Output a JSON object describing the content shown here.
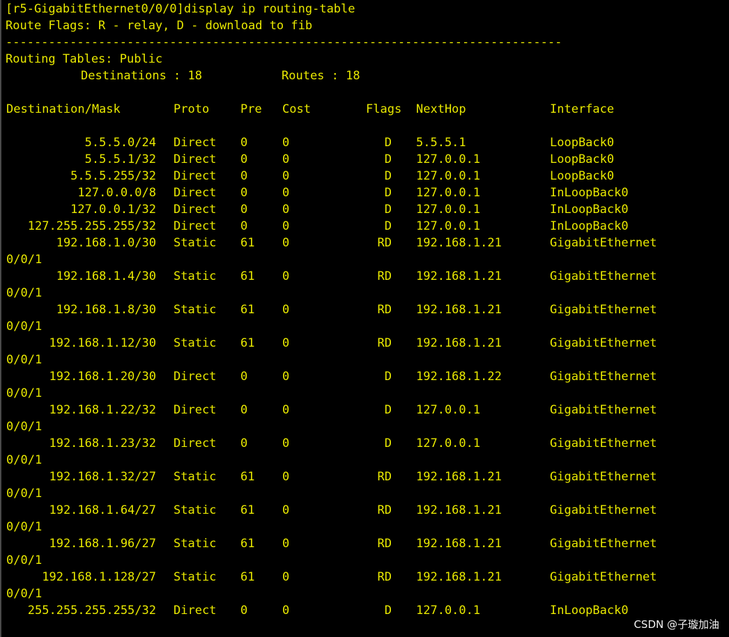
{
  "colors": {
    "background": "#000000",
    "text": "#e8e800",
    "watermark": "#ffffff"
  },
  "command": "[r5-GigabitEthernet0/0/0]display ip routing-table",
  "route_flags": "Route Flags: R - relay, D - download to fib",
  "separator": "------------------------------------------------------------------------------",
  "table_name": "Routing Tables: Public",
  "destinations_label": "Destinations : 18",
  "routes_label": "Routes : 18",
  "headers": {
    "destination": "Destination/Mask",
    "proto": "Proto",
    "pre": "Pre",
    "cost": "Cost",
    "flags": "Flags",
    "nexthop": "NextHop",
    "interface": "Interface"
  },
  "routes": [
    {
      "dest": "5.5.5.0/24",
      "proto": "Direct",
      "pre": "0",
      "cost": "0",
      "flags": "D",
      "nexthop": "5.5.5.1",
      "iface": "LoopBack0",
      "iface2": ""
    },
    {
      "dest": "5.5.5.1/32",
      "proto": "Direct",
      "pre": "0",
      "cost": "0",
      "flags": "D",
      "nexthop": "127.0.0.1",
      "iface": "LoopBack0",
      "iface2": ""
    },
    {
      "dest": "5.5.5.255/32",
      "proto": "Direct",
      "pre": "0",
      "cost": "0",
      "flags": "D",
      "nexthop": "127.0.0.1",
      "iface": "LoopBack0",
      "iface2": ""
    },
    {
      "dest": "127.0.0.0/8",
      "proto": "Direct",
      "pre": "0",
      "cost": "0",
      "flags": "D",
      "nexthop": "127.0.0.1",
      "iface": "InLoopBack0",
      "iface2": ""
    },
    {
      "dest": "127.0.0.1/32",
      "proto": "Direct",
      "pre": "0",
      "cost": "0",
      "flags": "D",
      "nexthop": "127.0.0.1",
      "iface": "InLoopBack0",
      "iface2": ""
    },
    {
      "dest": "127.255.255.255/32",
      "proto": "Direct",
      "pre": "0",
      "cost": "0",
      "flags": "D",
      "nexthop": "127.0.0.1",
      "iface": "InLoopBack0",
      "iface2": ""
    },
    {
      "dest": "192.168.1.0/30",
      "proto": "Static",
      "pre": "61",
      "cost": "0",
      "flags": "RD",
      "nexthop": "192.168.1.21",
      "iface": "GigabitEthernet",
      "iface2": "0/0/1"
    },
    {
      "dest": "192.168.1.4/30",
      "proto": "Static",
      "pre": "61",
      "cost": "0",
      "flags": "RD",
      "nexthop": "192.168.1.21",
      "iface": "GigabitEthernet",
      "iface2": "0/0/1"
    },
    {
      "dest": "192.168.1.8/30",
      "proto": "Static",
      "pre": "61",
      "cost": "0",
      "flags": "RD",
      "nexthop": "192.168.1.21",
      "iface": "GigabitEthernet",
      "iface2": "0/0/1"
    },
    {
      "dest": "192.168.1.12/30",
      "proto": "Static",
      "pre": "61",
      "cost": "0",
      "flags": "RD",
      "nexthop": "192.168.1.21",
      "iface": "GigabitEthernet",
      "iface2": "0/0/1"
    },
    {
      "dest": "192.168.1.20/30",
      "proto": "Direct",
      "pre": "0",
      "cost": "0",
      "flags": "D",
      "nexthop": "192.168.1.22",
      "iface": "GigabitEthernet",
      "iface2": "0/0/1"
    },
    {
      "dest": "192.168.1.22/32",
      "proto": "Direct",
      "pre": "0",
      "cost": "0",
      "flags": "D",
      "nexthop": "127.0.0.1",
      "iface": "GigabitEthernet",
      "iface2": "0/0/1"
    },
    {
      "dest": "192.168.1.23/32",
      "proto": "Direct",
      "pre": "0",
      "cost": "0",
      "flags": "D",
      "nexthop": "127.0.0.1",
      "iface": "GigabitEthernet",
      "iface2": "0/0/1"
    },
    {
      "dest": "192.168.1.32/27",
      "proto": "Static",
      "pre": "61",
      "cost": "0",
      "flags": "RD",
      "nexthop": "192.168.1.21",
      "iface": "GigabitEthernet",
      "iface2": "0/0/1"
    },
    {
      "dest": "192.168.1.64/27",
      "proto": "Static",
      "pre": "61",
      "cost": "0",
      "flags": "RD",
      "nexthop": "192.168.1.21",
      "iface": "GigabitEthernet",
      "iface2": "0/0/1"
    },
    {
      "dest": "192.168.1.96/27",
      "proto": "Static",
      "pre": "61",
      "cost": "0",
      "flags": "RD",
      "nexthop": "192.168.1.21",
      "iface": "GigabitEthernet",
      "iface2": "0/0/1"
    },
    {
      "dest": "192.168.1.128/27",
      "proto": "Static",
      "pre": "61",
      "cost": "0",
      "flags": "RD",
      "nexthop": "192.168.1.21",
      "iface": "GigabitEthernet",
      "iface2": "0/0/1"
    },
    {
      "dest": "255.255.255.255/32",
      "proto": "Direct",
      "pre": "0",
      "cost": "0",
      "flags": "D",
      "nexthop": "127.0.0.1",
      "iface": "InLoopBack0",
      "iface2": ""
    }
  ],
  "watermark": "CSDN @子璇加油"
}
